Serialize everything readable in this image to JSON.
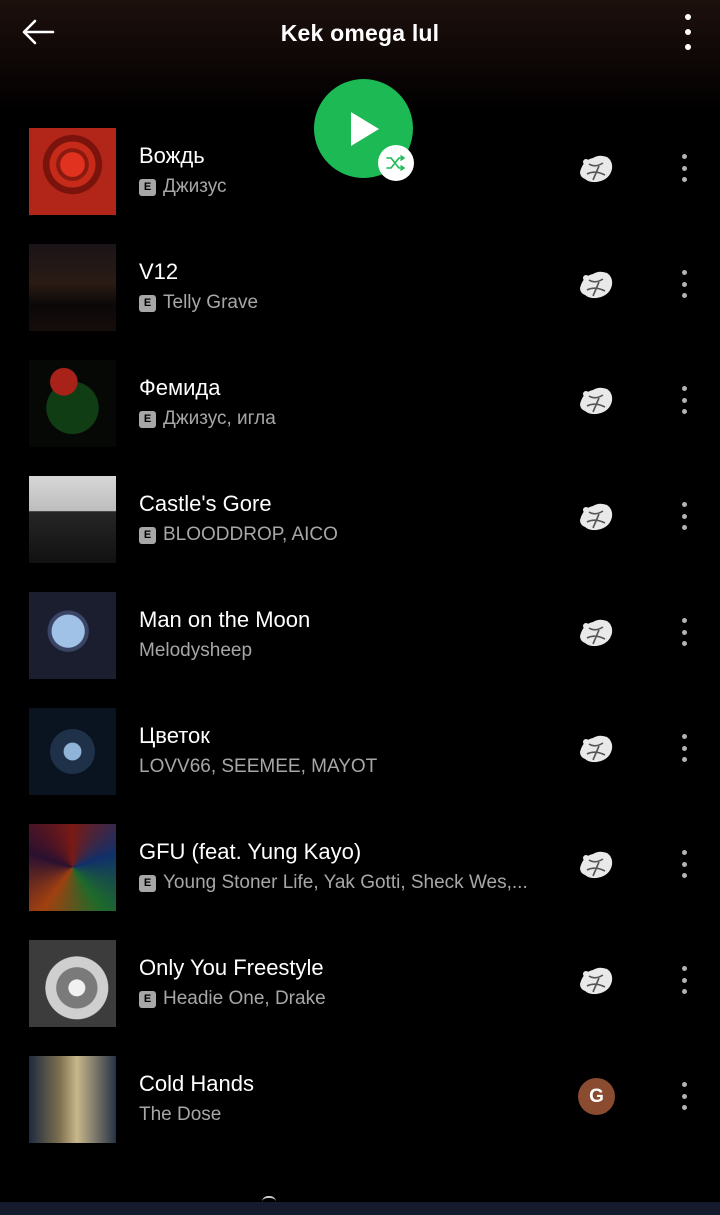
{
  "header": {
    "title": "Kek omega lul"
  },
  "explicit_label": "E",
  "colors": {
    "accent": "#1db954",
    "background": "#000000",
    "secondary_text": "#a7a7a7"
  },
  "tracks": [
    {
      "name": "Вождь",
      "explicit": true,
      "artists": "Джизус",
      "added_by": "avatar"
    },
    {
      "name": "V12",
      "explicit": true,
      "artists": "Telly Grave",
      "added_by": "avatar"
    },
    {
      "name": "Фемида",
      "explicit": true,
      "artists": "Джизус, игла",
      "added_by": "avatar"
    },
    {
      "name": "Castle's Gore",
      "explicit": true,
      "artists": "BLOODDROP, AICO",
      "added_by": "avatar"
    },
    {
      "name": "Man on the Moon",
      "explicit": false,
      "artists": "Melodysheep",
      "added_by": "avatar"
    },
    {
      "name": "Цветок",
      "explicit": false,
      "artists": "LOVV66, SEEMEE, MAYOT",
      "added_by": "avatar"
    },
    {
      "name": "GFU (feat. Yung Kayo)",
      "explicit": true,
      "artists": "Young Stoner Life, Yak Gotti, Sheck Wes,...",
      "added_by": "avatar"
    },
    {
      "name": "Only You Freestyle",
      "explicit": true,
      "artists": "Headie One, Drake",
      "added_by": "avatar"
    },
    {
      "name": "Cold Hands",
      "explicit": false,
      "artists": "The Dose",
      "added_by": "G"
    }
  ],
  "icons": {
    "back": "arrow-left-icon",
    "menu": "more-vertical-icon",
    "play": "play-icon",
    "shuffle": "shuffle-icon"
  }
}
